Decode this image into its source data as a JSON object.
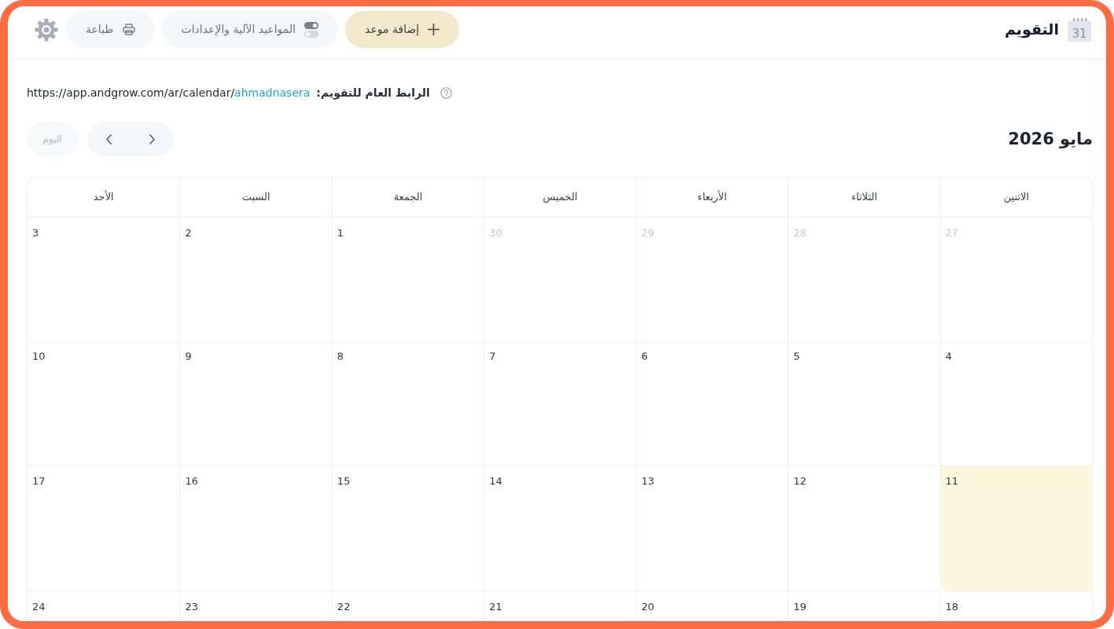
{
  "header": {
    "title": "التقويم",
    "icon_label": "31",
    "buttons": [
      {
        "label": "إضافة موعد",
        "kind": "primary"
      },
      {
        "label": "المواعيد الآلية والإعدادات",
        "kind": "secondary"
      },
      {
        "label": "طباعة",
        "kind": "secondary"
      }
    ]
  },
  "public_link": {
    "label": "الرابط العام للتقويم:",
    "url_base": "https://app.andgrow.com/ar/calendar/",
    "handle": "ahmadnasera"
  },
  "month_title": "مايو 2026",
  "today_button": {
    "label": "اليوم",
    "disabled": true
  },
  "calendar": {
    "weekdays": [
      "الاثنين",
      "الثلاثاء",
      "الأربعاء",
      "الخميس",
      "الجمعة",
      "السبت",
      "الأحد"
    ],
    "weeks": [
      [
        {
          "day": "27",
          "outside": true,
          "today": false
        },
        {
          "day": "28",
          "outside": true,
          "today": false
        },
        {
          "day": "29",
          "outside": true,
          "today": false
        },
        {
          "day": "30",
          "outside": true,
          "today": false
        },
        {
          "day": "1",
          "outside": false,
          "today": false
        },
        {
          "day": "2",
          "outside": false,
          "today": false
        },
        {
          "day": "3",
          "outside": false,
          "today": false
        }
      ],
      [
        {
          "day": "4",
          "outside": false,
          "today": false
        },
        {
          "day": "5",
          "outside": false,
          "today": false
        },
        {
          "day": "6",
          "outside": false,
          "today": false
        },
        {
          "day": "7",
          "outside": false,
          "today": false
        },
        {
          "day": "8",
          "outside": false,
          "today": false
        },
        {
          "day": "9",
          "outside": false,
          "today": false
        },
        {
          "day": "10",
          "outside": false,
          "today": false
        }
      ],
      [
        {
          "day": "11",
          "outside": false,
          "today": true
        },
        {
          "day": "12",
          "outside": false,
          "today": false
        },
        {
          "day": "13",
          "outside": false,
          "today": false
        },
        {
          "day": "14",
          "outside": false,
          "today": false
        },
        {
          "day": "15",
          "outside": false,
          "today": false
        },
        {
          "day": "16",
          "outside": false,
          "today": false
        },
        {
          "day": "17",
          "outside": false,
          "today": false
        }
      ],
      [
        {
          "day": "18",
          "outside": false,
          "today": false
        },
        {
          "day": "19",
          "outside": false,
          "today": false
        },
        {
          "day": "20",
          "outside": false,
          "today": false
        },
        {
          "day": "21",
          "outside": false,
          "today": false
        },
        {
          "day": "22",
          "outside": false,
          "today": false
        },
        {
          "day": "23",
          "outside": false,
          "today": false
        },
        {
          "day": "24",
          "outside": false,
          "today": false
        }
      ]
    ]
  }
}
